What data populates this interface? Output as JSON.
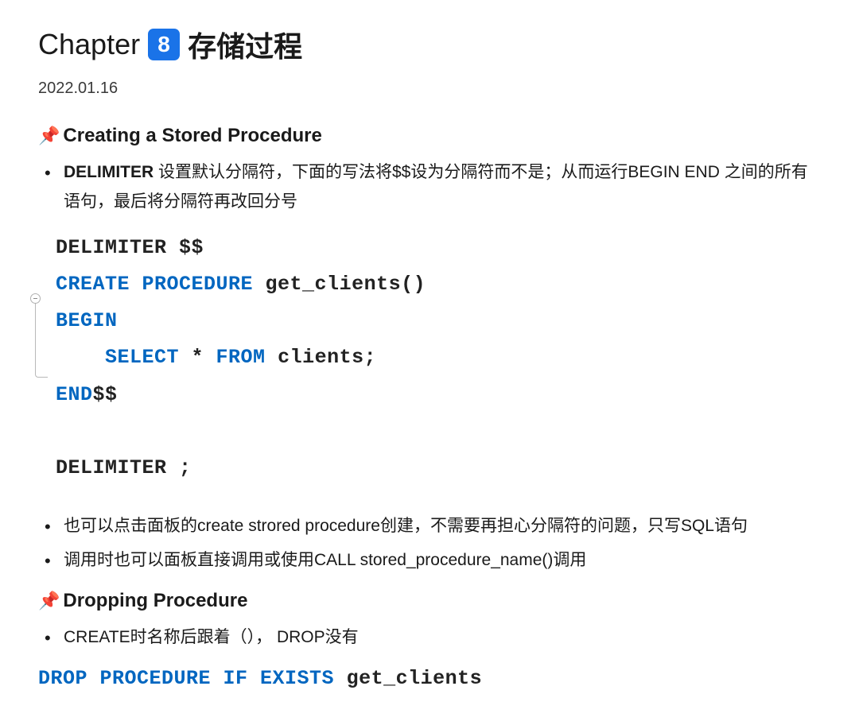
{
  "title": {
    "chapter_label": "Chapter",
    "badge_number": "8",
    "title_text": "存储过程"
  },
  "date": "2022.01.16",
  "section1": {
    "heading": "Creating a Stored Procedure",
    "bullets": [
      {
        "bold": "DELIMITER",
        "rest": " 设置默认分隔符，下面的写法将$$设为分隔符而不是；从而运行BEGIN END 之间的所有语句，最后将分隔符再改回分号"
      },
      {
        "bold": "",
        "rest": "也可以点击面板的create strored procedure创建，不需要再担心分隔符的问题，只写SQL语句"
      },
      {
        "bold": "",
        "rest": "调用时也可以面板直接调用或使用CALL stored_procedure_name()调用"
      }
    ],
    "code": {
      "l1a": "DELIMITER",
      "l1b": " $$",
      "l2a": "CREATE PROCEDURE",
      "l2b": " get_clients()",
      "l3": "BEGIN",
      "l4a": "    SELECT",
      "l4b": " * ",
      "l4c": "FROM",
      "l4d": " clients;",
      "l5a": "END",
      "l5b": "$$",
      "l7a": "DELIMITER",
      "l7b": " ;"
    }
  },
  "section2": {
    "heading": "Dropping Procedure",
    "bullets": [
      {
        "text": "CREATE时名称后跟着（）， DROP没有"
      }
    ],
    "code": {
      "l1a": "DROP PROCEDURE IF EXISTS",
      "l1b": " get_clients"
    }
  }
}
